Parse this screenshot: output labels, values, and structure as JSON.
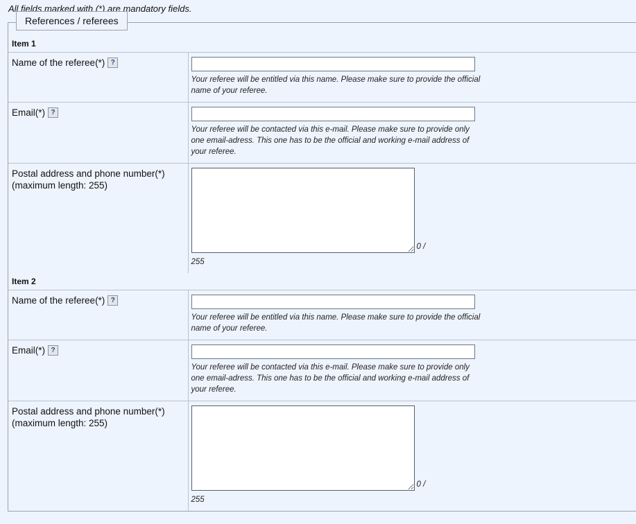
{
  "page": {
    "mandatory_note": "All fields marked with (*) are mandatory fields.",
    "background_color": "#eef4fd",
    "border_color": "#9aa3ad",
    "divider_color": "#b9c2cc"
  },
  "fieldset": {
    "legend": "References / referees"
  },
  "help_icon_glyph": "?",
  "items": [
    {
      "heading": "Item 1",
      "fields": [
        {
          "label": "Name of the referee(*)",
          "type": "text",
          "value": "",
          "help": "?",
          "hint": "Your referee will be entitled via this name. Please make sure to provide the official name of your referee."
        },
        {
          "label": "Email(*)",
          "type": "text",
          "value": "",
          "help": "?",
          "hint": "Your referee will be contacted via this e-mail. Please make sure to provide only one email-adress. This one has to be the official and working e-mail address of your referee."
        },
        {
          "label": "Postal address and phone number(*)",
          "label_line2": "(maximum length: 255)",
          "type": "textarea",
          "value": "",
          "counter_current": "0 /",
          "counter_max": "255"
        }
      ]
    },
    {
      "heading": "Item 2",
      "fields": [
        {
          "label": "Name of the referee(*)",
          "type": "text",
          "value": "",
          "help": "?",
          "hint": "Your referee will be entitled via this name. Please make sure to provide the official name of your referee."
        },
        {
          "label": "Email(*)",
          "type": "text",
          "value": "",
          "help": "?",
          "hint": "Your referee will be contacted via this e-mail. Please make sure to provide only one email-adress. This one has to be the official and working e-mail address of your referee."
        },
        {
          "label": "Postal address and phone number(*)",
          "label_line2": "(maximum length: 255)",
          "type": "textarea",
          "value": "",
          "counter_current": "0 /",
          "counter_max": "255"
        }
      ]
    }
  ]
}
